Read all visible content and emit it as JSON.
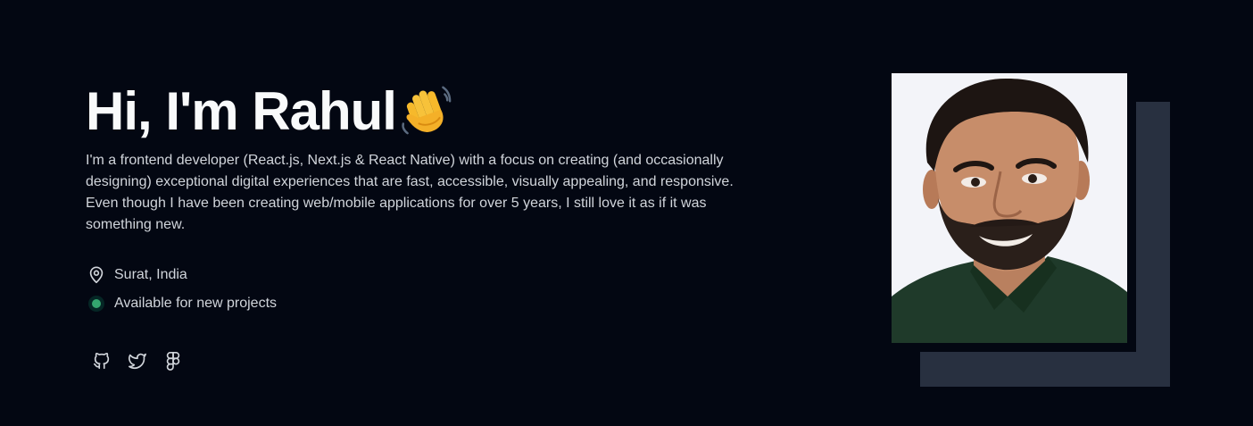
{
  "hero": {
    "heading": "Hi, I'm Rahul",
    "wave_icon": "waving-hand-emoji",
    "bio": "I'm a frontend developer (React.js, Next.js & React Native) with a focus on creating (and occasionally designing) exceptional digital experiences that are fast, accessible, visually appealing, and responsive. Even though I have been creating web/mobile applications for over 5 years, I still love it as if it was something new."
  },
  "meta": {
    "location": "Surat, India",
    "location_icon": "map-pin-icon",
    "availability": "Available for new projects",
    "availability_color": "#34a56f"
  },
  "socials": [
    {
      "icon": "github-icon"
    },
    {
      "icon": "twitter-icon"
    },
    {
      "icon": "figma-icon"
    }
  ],
  "photo": {
    "alt": "Rahul",
    "shadow_color": "#283040"
  },
  "colors": {
    "background": "#030712",
    "heading": "#f9fafb",
    "text": "#d1d5db"
  }
}
